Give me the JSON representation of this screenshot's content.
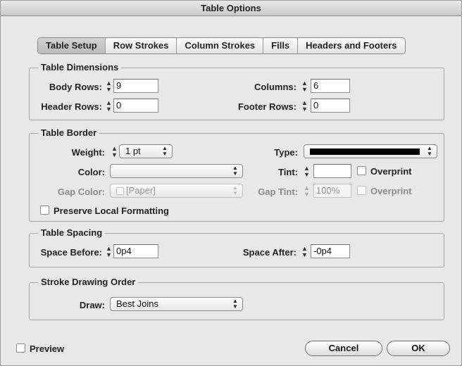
{
  "window": {
    "title": "Table Options"
  },
  "tabs": [
    {
      "label": "Table Setup"
    },
    {
      "label": "Row Strokes"
    },
    {
      "label": "Column Strokes"
    },
    {
      "label": "Fills"
    },
    {
      "label": "Headers and Footers"
    }
  ],
  "table_dimensions": {
    "legend": "Table Dimensions",
    "body_rows_label": "Body Rows:",
    "body_rows_value": "9",
    "header_rows_label": "Header Rows:",
    "header_rows_value": "0",
    "columns_label": "Columns:",
    "columns_value": "6",
    "footer_rows_label": "Footer Rows:",
    "footer_rows_value": "0"
  },
  "table_border": {
    "legend": "Table Border",
    "weight_label": "Weight:",
    "weight_value": "1 pt",
    "type_label": "Type:",
    "color_label": "Color:",
    "color_value": "",
    "tint_label": "Tint:",
    "tint_value": "",
    "overprint_label": "Overprint",
    "gap_color_label": "Gap Color:",
    "gap_color_value": "[Paper]",
    "gap_tint_label": "Gap Tint:",
    "gap_tint_value": "100%",
    "gap_overprint_label": "Overprint",
    "preserve_label": "Preserve Local Formatting"
  },
  "table_spacing": {
    "legend": "Table Spacing",
    "space_before_label": "Space Before:",
    "space_before_value": "0p4",
    "space_after_label": "Space After:",
    "space_after_value": "-0p4"
  },
  "stroke_order": {
    "legend": "Stroke Drawing Order",
    "draw_label": "Draw:",
    "draw_value": "Best Joins"
  },
  "footer": {
    "preview_label": "Preview",
    "cancel_label": "Cancel",
    "ok_label": "OK"
  }
}
